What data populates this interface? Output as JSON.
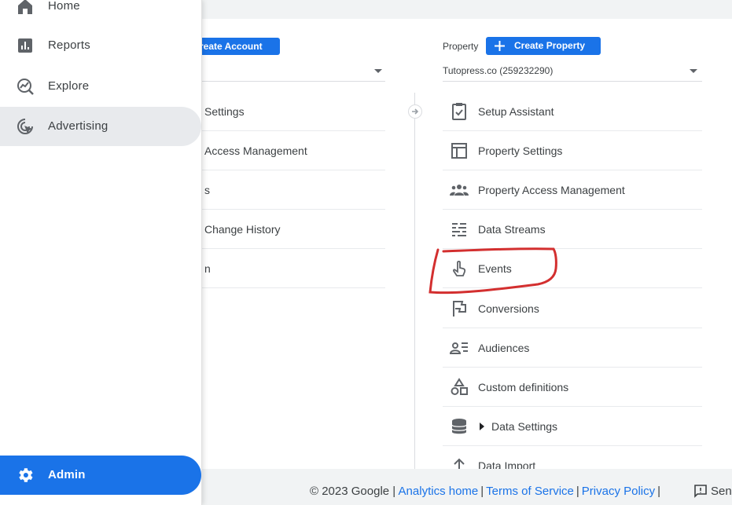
{
  "sidebar": {
    "items": [
      {
        "label": "Home",
        "icon": "home-icon"
      },
      {
        "label": "Reports",
        "icon": "reports-icon"
      },
      {
        "label": "Explore",
        "icon": "explore-icon"
      },
      {
        "label": "Advertising",
        "icon": "advertising-icon",
        "active": true
      }
    ],
    "admin": {
      "label": "Admin",
      "icon": "gear-icon"
    }
  },
  "account": {
    "create_label": "reate Account",
    "items": [
      "Settings",
      "Access Management",
      "s",
      "Change History",
      "n"
    ]
  },
  "property": {
    "label": "Property",
    "create_label": "Create Property",
    "selected": "Tutopress.co (259232290)",
    "items": [
      {
        "label": "Setup Assistant",
        "icon": "clipboard-check-icon"
      },
      {
        "label": "Property Settings",
        "icon": "layout-icon"
      },
      {
        "label": "Property Access Management",
        "icon": "people-icon"
      },
      {
        "label": "Data Streams",
        "icon": "data-streams-icon"
      },
      {
        "label": "Events",
        "icon": "touch-icon"
      },
      {
        "label": "Conversions",
        "icon": "flag-icon"
      },
      {
        "label": "Audiences",
        "icon": "audiences-icon"
      },
      {
        "label": "Custom definitions",
        "icon": "shapes-icon"
      },
      {
        "label": "Data Settings",
        "icon": "database-icon"
      },
      {
        "label": "Data Import",
        "icon": "upload-icon"
      }
    ]
  },
  "footer": {
    "copyright": "© 2023 Google |",
    "links": [
      "Analytics home",
      "Terms of Service",
      "Privacy Policy"
    ],
    "feedback": "Sen"
  },
  "colors": {
    "primary": "#1a73e8",
    "highlight": "#d32f2f",
    "active_bg": "#e8eaed"
  }
}
